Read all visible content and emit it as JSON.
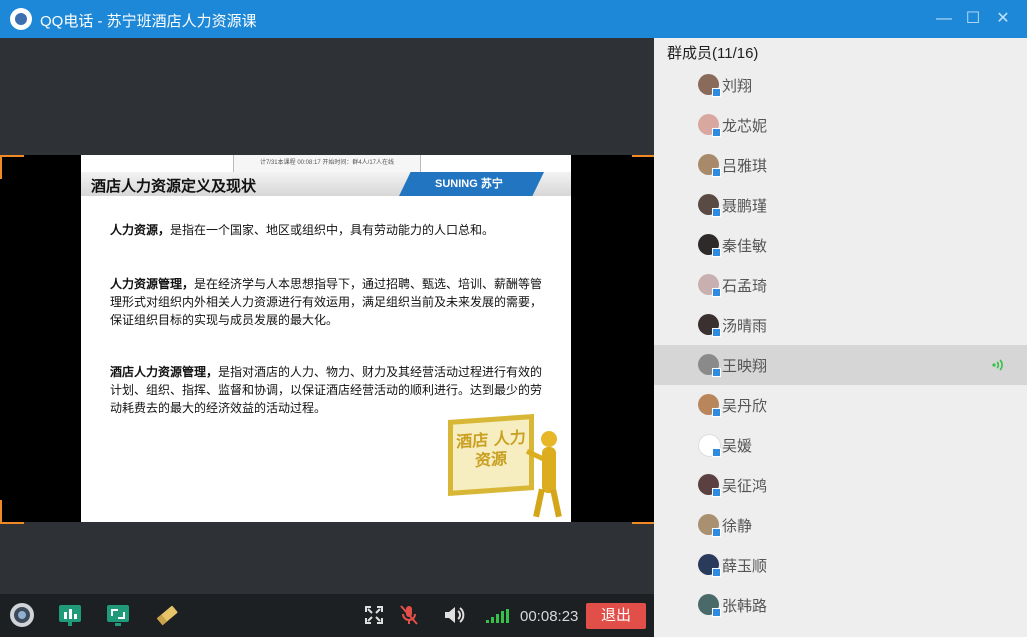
{
  "window": {
    "title": "QQ电话 - 苏宁班酒店人力资源课",
    "controls": [
      "minimize",
      "maximize",
      "close"
    ]
  },
  "slide": {
    "top_strip": "计7/31本课程 00:08:17 开始时间：群4人/17人在线",
    "title": "酒店人力资源定义及现状",
    "brand": "SUNING 苏宁",
    "paragraphs": [
      {
        "term": "人力资源，",
        "text": "是指在一个国家、地区或组织中，具有劳动能力的人口总和。"
      },
      {
        "term": "人力资源管理，",
        "text": "是在经济学与人本思想指导下，通过招聘、甄选、培训、薪酬等管理形式对组织内外相关人力资源进行有效运用，满足组织当前及未来发展的需要，保证组织目标的实现与成员发展的最大化。"
      },
      {
        "term": "酒店人力资源管理，",
        "text": "是指对酒店的人力、物力、财力及其经营活动过程进行有效的计划、组织、指挥、监督和协调，以保证酒店经营活动的顺利进行。达到最少的劳动耗费去的最大的经济效益的活动过程。"
      }
    ],
    "board_text": "酒店 人力资源"
  },
  "toolbar": {
    "timer": "00:08:23",
    "quit_label": "退出",
    "icons": [
      "camera-icon",
      "whiteboard-icon",
      "screen-share-icon",
      "eraser-icon",
      "fullscreen-icon",
      "mic-muted-icon",
      "speaker-icon",
      "signal-icon"
    ]
  },
  "members_panel": {
    "header": "群成员(11/16)",
    "members": [
      {
        "name": "刘翔",
        "color": "#8a6a5a"
      },
      {
        "name": "龙芯妮",
        "color": "#d8a8a0"
      },
      {
        "name": "吕雅琪",
        "color": "#a88a6a"
      },
      {
        "name": "聂鹏瑾",
        "color": "#5a4a44"
      },
      {
        "name": "秦佳敏",
        "color": "#2e2a2a"
      },
      {
        "name": "石孟琦",
        "color": "#c8b0b0"
      },
      {
        "name": "汤晴雨",
        "color": "#3a3030"
      },
      {
        "name": "王映翔",
        "color": "#8a8a8a",
        "active": true
      },
      {
        "name": "吴丹欣",
        "color": "#b8865a"
      },
      {
        "name": "吴媛",
        "color": "#ffffff"
      },
      {
        "name": "吴征鸿",
        "color": "#5a4040"
      },
      {
        "name": "徐静",
        "color": "#a89070"
      },
      {
        "name": "薛玉顺",
        "color": "#2a3a5a"
      },
      {
        "name": "张韩路",
        "color": "#4a6a6a"
      }
    ]
  }
}
